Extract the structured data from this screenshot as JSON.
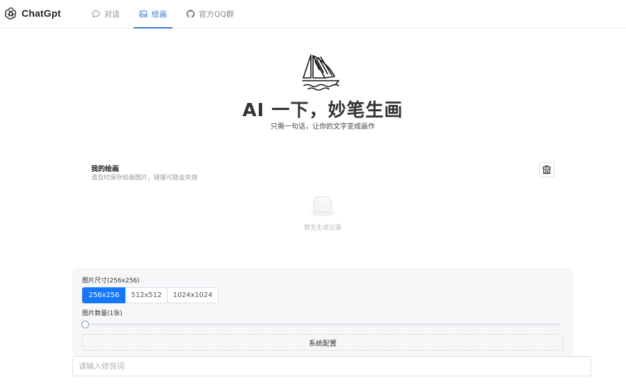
{
  "header": {
    "brand": "ChatGpt",
    "nav": [
      {
        "label": "对话",
        "icon": "chat-bubble-icon"
      },
      {
        "label": "绘画",
        "icon": "image-icon",
        "active": true
      },
      {
        "label": "官方QQ群",
        "icon": "github-icon"
      }
    ]
  },
  "hero": {
    "title": "AI 一下，妙笔生画",
    "subtitle": "只需一句话，让你的文字变成画作"
  },
  "gallery": {
    "title": "我的绘画",
    "description": "请及时保存绘画图片，链接可能会失效",
    "empty_text": "暂无生成记录",
    "action_icon": "shop-icon"
  },
  "config": {
    "size_label": "图片尺寸(256x256)",
    "sizes": [
      "256x256",
      "512x512",
      "1024x1024"
    ],
    "selected_size": "256x256",
    "count_label": "图片数量(1张)",
    "system_button": "系统配置"
  },
  "prompt": {
    "placeholder": "请输入修饰词",
    "value": ""
  },
  "colors": {
    "accent": "#1677ff",
    "nav_active": "#3a7bd5"
  }
}
